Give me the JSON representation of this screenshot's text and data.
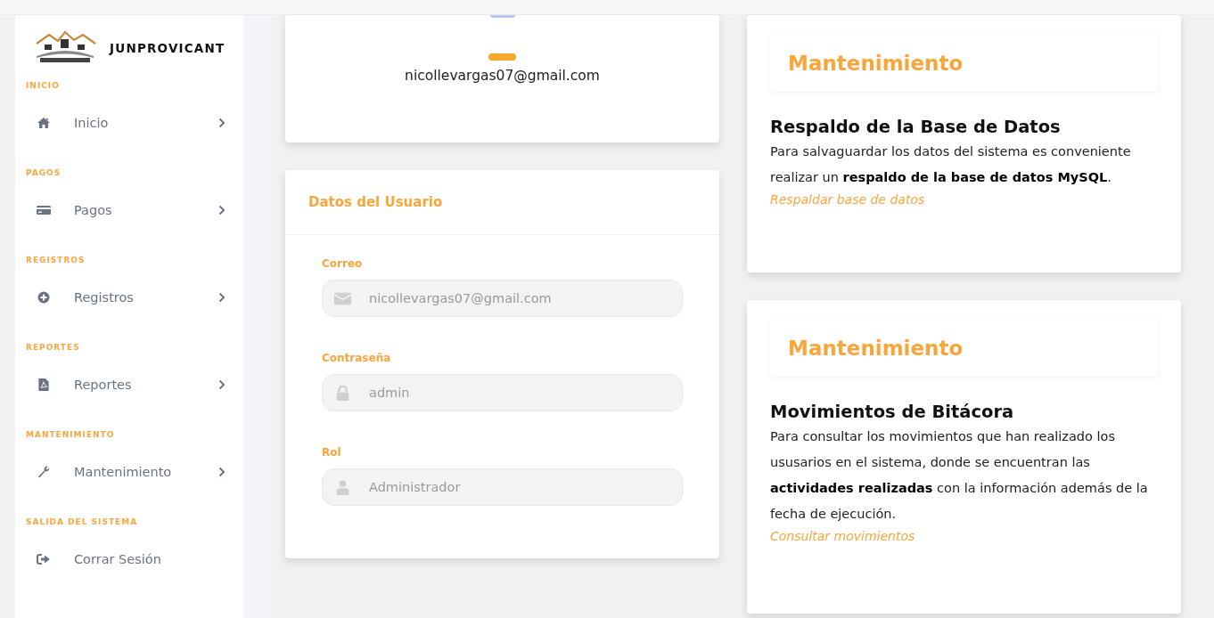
{
  "sidebar": {
    "brand": "JUNPROVICANT",
    "sections": [
      {
        "heading": "INICIO",
        "item": {
          "label": "Inicio",
          "expandable": true
        }
      },
      {
        "heading": "PAGOS",
        "item": {
          "label": "Pagos",
          "expandable": true
        }
      },
      {
        "heading": "REGISTROS",
        "item": {
          "label": "Registros",
          "expandable": true
        }
      },
      {
        "heading": "REPORTES",
        "item": {
          "label": "Reportes",
          "expandable": true
        }
      },
      {
        "heading": "MANTENIMIENTO",
        "item": {
          "label": "Mantenimiento",
          "expandable": true
        }
      },
      {
        "heading": "SALIDA DEL SISTEMA",
        "item": {
          "label": "Corrar Sesión",
          "expandable": false
        }
      }
    ]
  },
  "profile_card": {
    "email": "nicollevargas07@gmail.com"
  },
  "user_card": {
    "title": "Datos del Usuario",
    "fields": [
      {
        "label": "Correo",
        "value": "nicollevargas07@gmail.com"
      },
      {
        "label": "Contraseña",
        "value": "admin"
      },
      {
        "label": "Rol",
        "value": "Administrador"
      }
    ]
  },
  "maintenance_cards": [
    {
      "header": "Mantenimiento",
      "title": "Respaldo de la Base de Datos",
      "text": "Para salvaguardar los datos del sistema es conveniente realizar un **respaldo de la base de datos MySQL**.",
      "link": "Respaldar base de datos"
    },
    {
      "header": "Mantenimiento",
      "title": "Movimientos de Bitácora",
      "text": "Para consultar los movimientos que han realizado los ususarios en el sistema, donde se encuentran las **actividades realizadas** con la información además de la fecha de ejecución.",
      "link": "Consultar movimientos"
    }
  ]
}
